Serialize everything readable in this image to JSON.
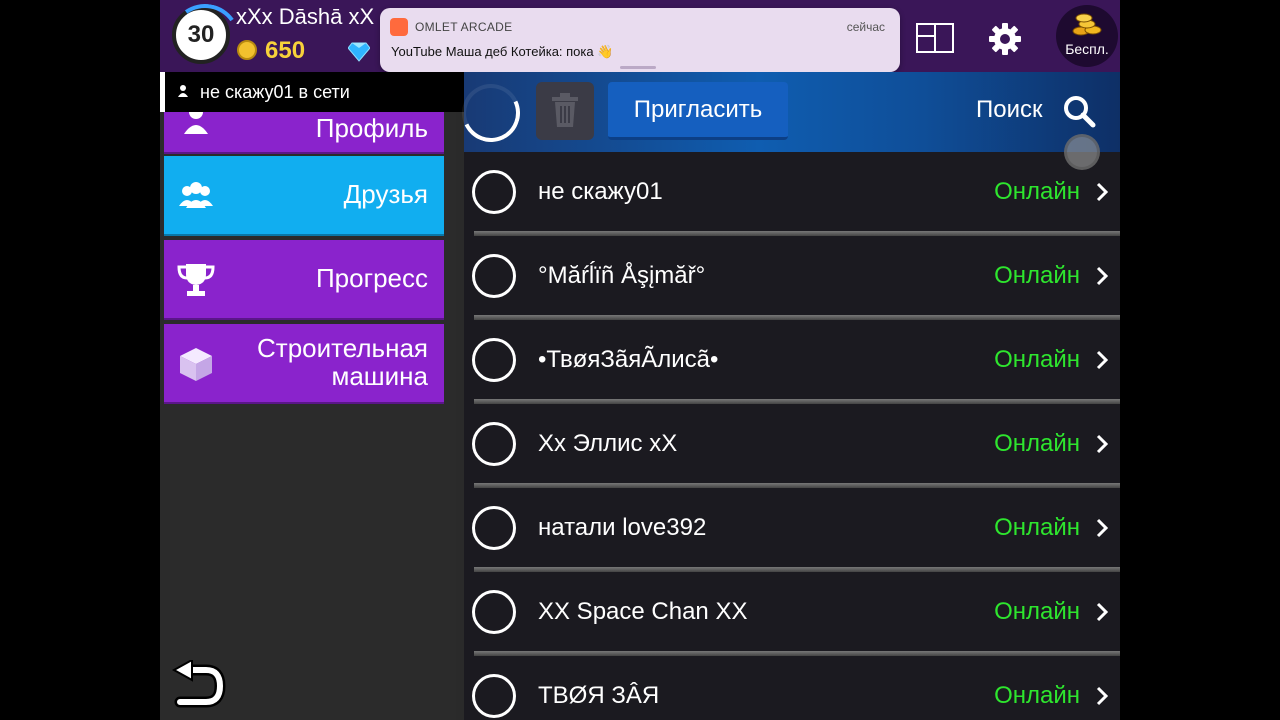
{
  "header": {
    "level": "30",
    "username": "xXx Dāshā xX",
    "coins": "650",
    "shop_label": "Беспл."
  },
  "notification": {
    "app": "OMLET ARCADE",
    "time": "сейчас",
    "message": "YouTube Маша деб Котейка: пока 👋"
  },
  "status": {
    "text": "не скажу01 в сети"
  },
  "sidebar": {
    "items": [
      {
        "label": "Профиль",
        "icon": "profile-icon"
      },
      {
        "label": "Друзья",
        "icon": "friends-icon"
      },
      {
        "label": "Прогресс",
        "icon": "trophy-icon"
      },
      {
        "label": "Строительная машина",
        "icon": "cube-icon"
      }
    ]
  },
  "toolbar": {
    "invite_label": "Пригласить",
    "search_label": "Поиск"
  },
  "friends": [
    {
      "name": "не скажу01",
      "status": "Онлайн"
    },
    {
      "name": "°Măŕĺïñ Åşįmăř°",
      "status": "Онлайн"
    },
    {
      "name": "•ТвøяЗãяÃлисã•",
      "status": "Онлайн"
    },
    {
      "name": "Хх Эллис хХ",
      "status": "Онлайн"
    },
    {
      "name": "натали love392",
      "status": "Онлайн"
    },
    {
      "name": "XX Space Chan XX",
      "status": "Онлайн"
    },
    {
      "name": "ТВØЯ ЗÂЯ",
      "status": "Онлайн"
    }
  ],
  "colors": {
    "online": "#2ee62e",
    "active_tab": "#11aef0",
    "tab": "#8a23cc"
  }
}
